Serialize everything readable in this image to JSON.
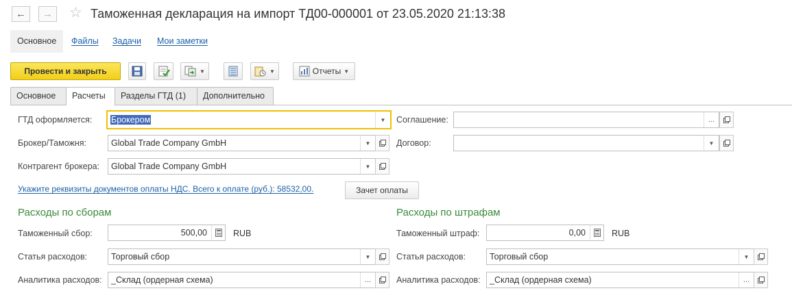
{
  "window": {
    "title": "Таможенная декларация на импорт ТД00-000001 от 23.05.2020 21:13:38"
  },
  "nav": {
    "back_glyph": "←",
    "forward_glyph": "→",
    "favorite_glyph": "☆"
  },
  "sections": [
    {
      "label": "Основное"
    },
    {
      "label": "Файлы"
    },
    {
      "label": "Задачи"
    },
    {
      "label": "Мои заметки"
    }
  ],
  "toolbar": {
    "post_close_label": "Провести и закрыть",
    "reports_label": "Отчеты",
    "dropdown_glyph": "▼",
    "icons": [
      "save-icon",
      "post-icon",
      "create-based-on-icon",
      "list-icon",
      "attachments-icon",
      "reports-icon"
    ]
  },
  "tabs": [
    {
      "label": "Основное"
    },
    {
      "label": "Расчеты"
    },
    {
      "label": "Разделы ГТД (1)"
    },
    {
      "label": "Дополнительно"
    }
  ],
  "form": {
    "gtd_by": {
      "label": "ГТД оформляется:",
      "value": "Брокером"
    },
    "broker": {
      "label": "Брокер/Таможня:",
      "value": "Global Trade Company GmbH"
    },
    "broker_contractor": {
      "label": "Контрагент брокера:",
      "value": "Global Trade Company GmbH"
    },
    "agreement": {
      "label": "Соглашение:",
      "value": ""
    },
    "contract": {
      "label": "Договор:",
      "value": ""
    },
    "vat_link": "Укажите реквизиты документов оплаты НДС. Всего к оплате (руб.): 58532,00.",
    "offset_button": "Зачет оплаты",
    "fees": {
      "title": "Расходы по сборам",
      "amount_label": "Таможенный сбор:",
      "amount_value": "500,00",
      "currency": "RUB",
      "item_label": "Статья расходов:",
      "item_value": "Торговый сбор",
      "analytics_label": "Аналитика расходов:",
      "analytics_value": "_Склад (ордерная схема)"
    },
    "fines": {
      "title": "Расходы по штрафам",
      "amount_label": "Таможенный штраф:",
      "amount_value": "0,00",
      "currency": "RUB",
      "item_label": "Статья расходов:",
      "item_value": "Торговый сбор",
      "analytics_label": "Аналитика расходов:",
      "analytics_value": "_Склад (ордерная схема)"
    }
  },
  "glyphs": {
    "dropdown": "▼",
    "select": "..."
  },
  "colors": {
    "primary_button": "#f2cf19",
    "link": "#1a5fa8",
    "group_title": "#3a8a3a",
    "focus_border": "#f0c000",
    "selection": "#3f68b8"
  }
}
